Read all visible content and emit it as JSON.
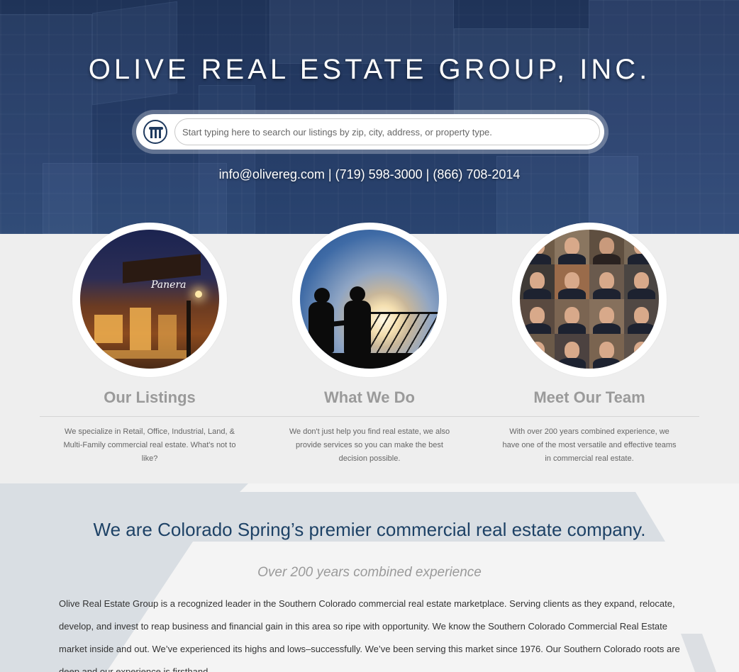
{
  "header": {
    "site_title": "OLIVE REAL ESTATE GROUP, INC.",
    "logo_icon": "columns-logo-icon",
    "search": {
      "placeholder": "Start typing here to search our listings by zip, city, address, or property type.",
      "value": ""
    },
    "contact_line": "info@olivereg.com | (719) 598-3000 | (866) 708-2014"
  },
  "features": [
    {
      "title": "Our Listings",
      "text": "We specialize in Retail, Office, Industrial, Land, & Multi-Family commercial real estate. What's not to like?",
      "image": "restaurant-photo"
    },
    {
      "title": "What We Do",
      "text": "We don't just help you find real estate, we also provide services so you can make the best decision possible.",
      "image": "handshake-photo"
    },
    {
      "title": "Meet Our Team",
      "text": "With over 200 years combined experience, we have one of the most versatile and effective teams in commercial real estate.",
      "image": "team-photo"
    }
  ],
  "about": {
    "heading": "We are Colorado Spring’s premier commercial real estate company.",
    "subheading": "Over 200 years combined experience",
    "body": "Olive Real Estate Group is a recognized leader in the Southern Colorado commercial real estate marketplace. Serving clients as they expand, relocate, develop, and invest to reap business and financial gain in this area so ripe with opportunity. We know the Southern Colorado Commercial Real Estate market inside and out. We’ve experienced its highs and lows–successfully. We’ve been serving this market since 1976. Our Southern Colorado roots are deep and our experience is firsthand."
  },
  "colors": {
    "hero_bg": "#243a63",
    "heading_blue": "#1e4266",
    "feature_title_gray": "#9a9a9a"
  }
}
